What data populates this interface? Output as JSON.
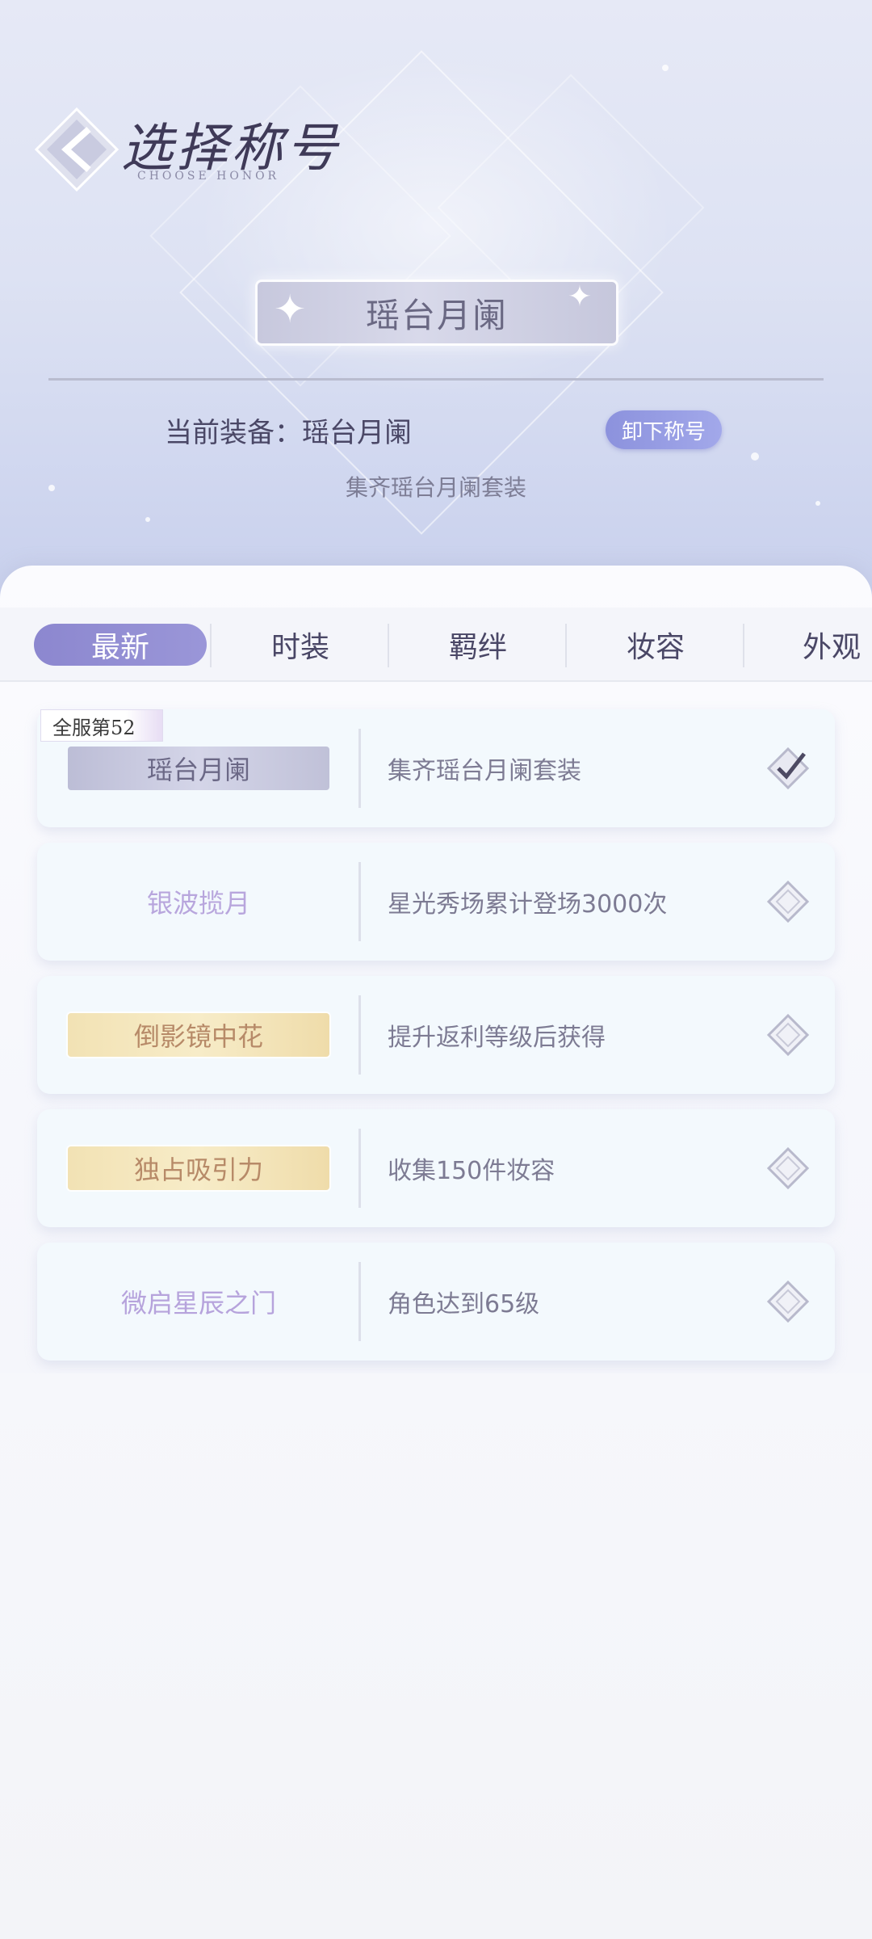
{
  "header": {
    "title": "选择称号",
    "subtitle": "CHOOSE HONOR"
  },
  "equipped_plaque": {
    "label": "瑶台月阑"
  },
  "current": {
    "text": "当前装备：瑶台月阑",
    "unequip_label": "卸下称号",
    "description": "集齐瑶台月阑套装"
  },
  "tabs": [
    {
      "label": "最新",
      "active": true
    },
    {
      "label": "时装",
      "active": false
    },
    {
      "label": "羁绊",
      "active": false
    },
    {
      "label": "妆容",
      "active": false
    },
    {
      "label": "外观",
      "active": false
    }
  ],
  "rank_badge": "全服第52",
  "titles": [
    {
      "name": "瑶台月阑",
      "condition": "集齐瑶台月阑套装",
      "style": "silver",
      "equipped": true
    },
    {
      "name": "银波揽月",
      "condition": "星光秀场累计登场3000次",
      "style": "plain-lilac",
      "equipped": false
    },
    {
      "name": "倒影镜中花",
      "condition": "提升返利等级后获得",
      "style": "gold",
      "equipped": false
    },
    {
      "name": "独占吸引力",
      "condition": "收集150件妆容",
      "style": "gold",
      "equipped": false
    },
    {
      "name": "微启星辰之门",
      "condition": "角色达到65级",
      "style": "plain-lilac2",
      "equipped": false
    }
  ],
  "colors": {
    "accent": "#8c87cf",
    "unequip_button": "#9aa0e6",
    "text_dark": "#4a4766",
    "gold_plaque": "#f2e2b4",
    "silver_plaque": "#c8c9de"
  },
  "icons": {
    "title_emblem": "diamond-arrow-emblem",
    "check": "diamond-check-icon",
    "empty": "diamond-outline-icon"
  }
}
